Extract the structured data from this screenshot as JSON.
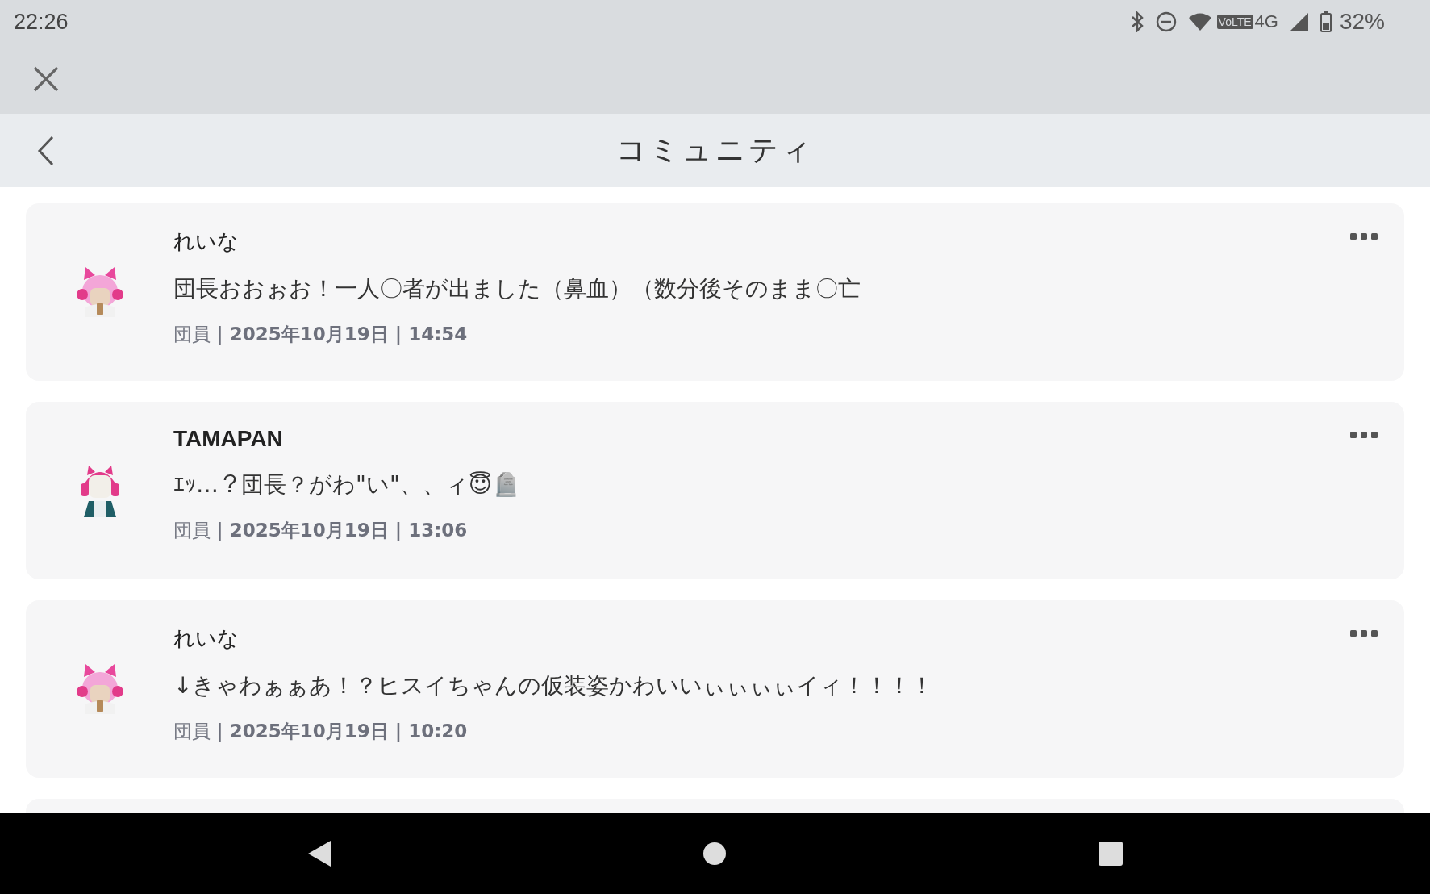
{
  "status_bar": {
    "time": "22:26",
    "network": "VoLTE",
    "network_type": "4G",
    "battery": "32%"
  },
  "header": {
    "title": "コミュニティ"
  },
  "posts": [
    {
      "author": "れいな",
      "author_bold": false,
      "kind": "pink",
      "message": "団長おおぉお！一人〇者が出ました（鼻血）（数分後そのまま〇亡",
      "meta": "団員 **| 2025年10月19日 | 14:54**"
    },
    {
      "author": "TAMAPAN",
      "author_bold": true,
      "kind": "headphones",
      "message": "ｴｯ…？団長？がわ\"い\"、、ィ😇🪦",
      "meta": "団員 **| 2025年10月19日 | 13:06**"
    },
    {
      "author": "れいな",
      "author_bold": false,
      "kind": "pink",
      "message": "↓きゃわぁぁあ！？ヒスイちゃんの仮装姿かわいいぃぃぃぃイィ！！！！",
      "meta": "団員 **| 2025年10月19日 | 10:20**"
    }
  ]
}
